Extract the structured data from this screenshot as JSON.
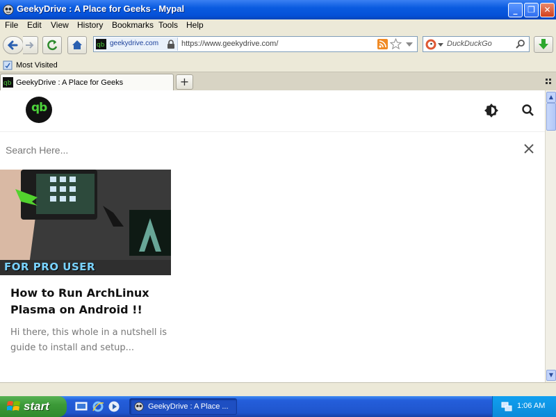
{
  "window": {
    "title": "GeekyDrive : A Place for Geeks - Mypal",
    "minimize_glyph": "_",
    "maximize_glyph": "❐",
    "close_glyph": "✕"
  },
  "menu": {
    "file": "File",
    "edit": "Edit",
    "view": "View",
    "history": "History",
    "bookmarks": "Bookmarks",
    "tools": "Tools",
    "help": "Help"
  },
  "nav": {
    "site_domain": "geekydrive.com",
    "url": "https://www.geekydrive.com/",
    "search_placeholder": "DuckDuckGo"
  },
  "bookmarks_bar": {
    "most_visited": "Most Visited"
  },
  "tabs": {
    "active_label": "GeekyDrive : A Place for Geeks",
    "new_tab_glyph": "+"
  },
  "page": {
    "logo_text": "qb",
    "search_placeholder": "Search Here...",
    "article": {
      "title": "How to Run ArchLinux Plasma on Android !!",
      "excerpt": "Hi there, this whole in a nutshell is guide to install and setup...",
      "thumbnail_caption": "FOR PRO USER"
    }
  },
  "taskbar": {
    "start_label": "start",
    "task_label": "GeekyDrive : A Place ...",
    "clock": "1:06 AM"
  },
  "colors": {
    "titlebar": "#0550d8",
    "logo_green": "#4cd13a",
    "taskbar_blue": "#245edb",
    "start_green": "#3c9a38"
  }
}
